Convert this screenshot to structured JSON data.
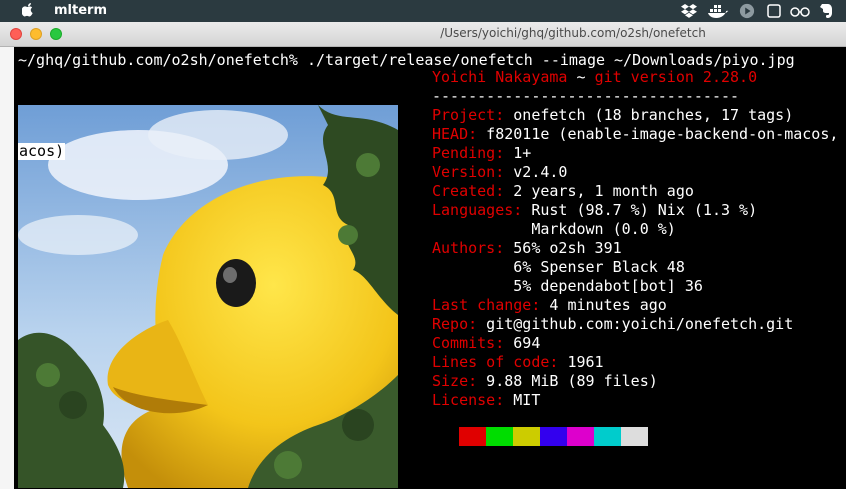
{
  "menubar": {
    "app_name": "mlterm"
  },
  "window": {
    "title": "/Users/yoichi/ghq/github.com/o2sh/onefetch"
  },
  "terminal": {
    "command_line": "~/ghq/github.com/o2sh/onefetch% ./target/release/onefetch --image ~/Downloads/piyo.jpg",
    "wrapped_fragment": "acos)",
    "header": {
      "user": "Yoichi Nakayama",
      "separator": " ~ ",
      "git_version": "git version 2.28.0"
    },
    "rule": "----------------------------------",
    "rows": [
      {
        "key": "Project:",
        "value": " onefetch (18 branches, 17 tags)"
      },
      {
        "key": "HEAD:",
        "value": " f82011e (enable-image-backend-on-macos,"
      },
      {
        "key": "Pending:",
        "value": " 1+"
      },
      {
        "key": "Version:",
        "value": " v2.4.0"
      },
      {
        "key": "Created:",
        "value": " 2 years, 1 month ago"
      },
      {
        "key": "Languages:",
        "value": " Rust (98.7 %) Nix (1.3 %)"
      },
      {
        "key": "",
        "value": "           Markdown (0.0 %)"
      },
      {
        "key": "Authors:",
        "value": " 56% o2sh 391"
      },
      {
        "key": "",
        "value": "         6% Spenser Black 48"
      },
      {
        "key": "",
        "value": "         5% dependabot[bot] 36"
      },
      {
        "key": "Last change:",
        "value": " 4 minutes ago"
      },
      {
        "key": "Repo:",
        "value": " git@github.com:yoichi/onefetch.git"
      },
      {
        "key": "Commits:",
        "value": " 694"
      },
      {
        "key": "Lines of code:",
        "value": " 1961"
      },
      {
        "key": "Size:",
        "value": " 9.88 MiB (89 files)"
      },
      {
        "key": "License:",
        "value": " MIT"
      }
    ],
    "palette": [
      "#e00000",
      "#00dd00",
      "#cccc00",
      "#3300ee",
      "#dd00cc",
      "#00cccc",
      "#dddddd"
    ]
  },
  "colors": {
    "key_red": "#e00000",
    "menubar_bg": "#2b3a40",
    "terminal_bg": "#000000"
  },
  "icons": [
    "apple-icon",
    "dropbox-icon",
    "docker-icon",
    "play-icon",
    "window-icon",
    "glasses-icon",
    "evernote-icon"
  ]
}
